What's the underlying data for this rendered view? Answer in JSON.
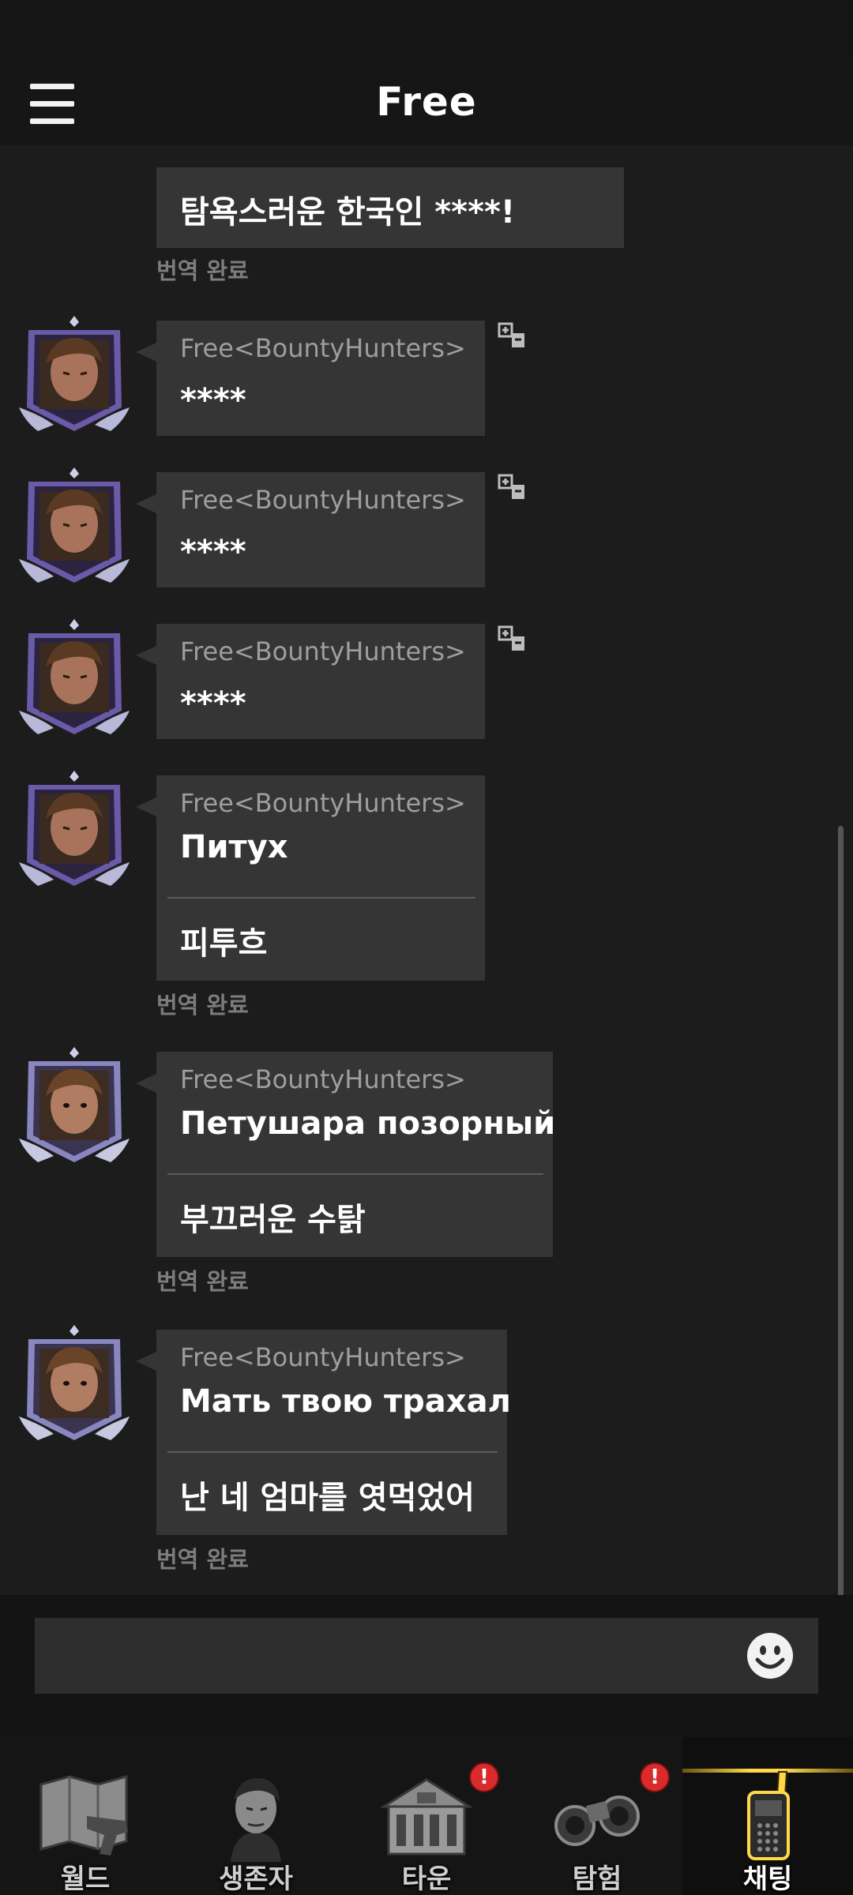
{
  "header": {
    "title": "Free"
  },
  "messages": [
    {
      "text": "탐욕스러운 한국인 ****!",
      "status": "번역 완료"
    },
    {
      "sender": "Free<BountyHunters>",
      "text": "****"
    },
    {
      "sender": "Free<BountyHunters>",
      "text": "****"
    },
    {
      "sender": "Free<BountyHunters>",
      "text": "****"
    },
    {
      "sender": "Free<BountyHunters>",
      "text": "Питух",
      "translation": "피투흐",
      "status": "번역 완료"
    },
    {
      "sender": "Free<BountyHunters>",
      "text": "Петушара позорный",
      "translation": "부끄러운 수탉",
      "status": "번역 완료"
    },
    {
      "sender": "Free<BountyHunters>",
      "text": "Мать твою трахал",
      "translation": "난 네 엄마를 엿먹었어",
      "status": "번역 완료"
    }
  ],
  "input": {
    "value": "",
    "placeholder": ""
  },
  "nav": [
    {
      "label": "월드",
      "icon": "world-map-icon",
      "alert": false
    },
    {
      "label": "생존자",
      "icon": "survivor-icon",
      "alert": false
    },
    {
      "label": "타운",
      "icon": "town-building-icon",
      "alert": true,
      "badge": "!"
    },
    {
      "label": "탐험",
      "icon": "binoculars-icon",
      "alert": true,
      "badge": "!"
    },
    {
      "label": "채팅",
      "icon": "walkie-talkie-icon",
      "alert": false,
      "active": true
    }
  ],
  "colors": {
    "accent": "#ffd84a",
    "alert": "#d92b2b",
    "bubble": "#353535",
    "background": "#1c1c1c"
  }
}
